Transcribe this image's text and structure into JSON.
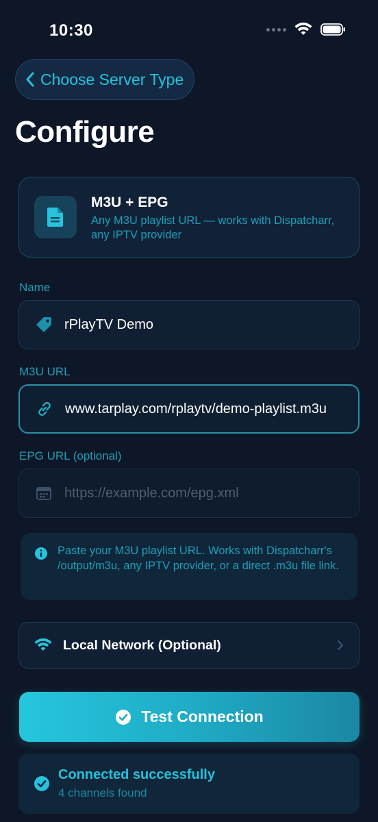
{
  "status_bar": {
    "time": "10:30"
  },
  "nav": {
    "back_label": "Choose Server Type"
  },
  "page": {
    "title": "Configure"
  },
  "server_type": {
    "title": "M3U + EPG",
    "description": "Any M3U playlist URL — works with Dispatcharr, any IPTV provider",
    "icon": "document-icon"
  },
  "fields": {
    "name": {
      "label": "Name",
      "value": "rPlayTV Demo",
      "icon": "tag-icon"
    },
    "m3u_url": {
      "label": "M3U URL",
      "value": "www.tarplay.com/rplaytv/demo-playlist.m3u",
      "icon": "link-icon"
    },
    "epg_url": {
      "label": "EPG URL (optional)",
      "value": "",
      "placeholder": "https://example.com/epg.xml",
      "icon": "calendar-icon"
    }
  },
  "info": {
    "text": "Paste your M3U playlist URL. Works with Dispatcharr's /output/m3u, any IPTV provider, or a direct .m3u file link.",
    "icon": "info-icon"
  },
  "local_network": {
    "label": "Local Network (Optional)",
    "icon": "wifi-icon"
  },
  "test_button": {
    "label": "Test Connection",
    "icon": "checkmark-circle-icon"
  },
  "result": {
    "title": "Connected successfully",
    "subtitle": "4 channels found",
    "icon": "checkmark-circle-icon"
  },
  "colors": {
    "background": "#0e1727",
    "accent": "#26c1da",
    "card": "#112238",
    "text_secondary": "#1f9fb8"
  }
}
